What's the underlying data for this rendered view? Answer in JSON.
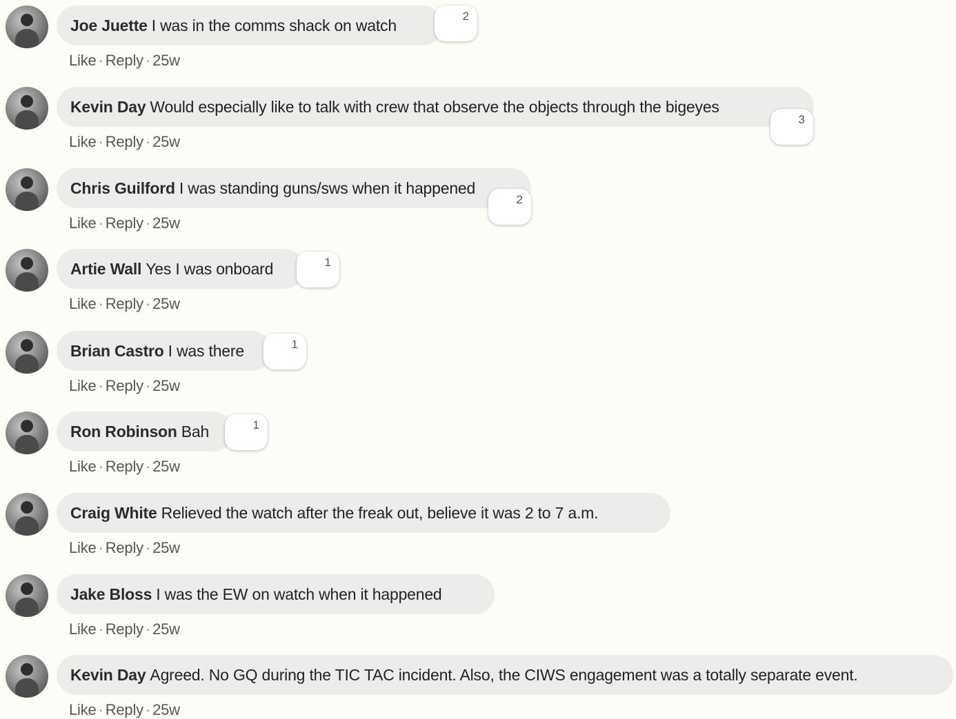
{
  "actions": {
    "like": "Like",
    "reply": "Reply",
    "separator": "·"
  },
  "comments": [
    {
      "author": "Joe Juette",
      "text": "I was in the comms shack on watch",
      "reactions": "2",
      "time": "25w"
    },
    {
      "author": "Kevin Day",
      "text": "Would especially like to talk with crew that observe the objects through the bigeyes",
      "reactions": "3",
      "time": "25w"
    },
    {
      "author": "Chris Guilford",
      "text": "I was standing guns/sws when it happened",
      "reactions": "2",
      "time": "25w"
    },
    {
      "author": "Artie Wall",
      "text": "Yes I was onboard",
      "reactions": "1",
      "time": "25w"
    },
    {
      "author": "Brian Castro",
      "text": "I was there",
      "reactions": "1",
      "time": "25w"
    },
    {
      "author": "Ron Robinson",
      "text": "Bah",
      "reactions": "1",
      "time": "25w"
    },
    {
      "author": "Craig White",
      "text": "Relieved the watch after the freak out, believe it was 2 to 7 a.m.",
      "reactions": "",
      "time": "25w"
    },
    {
      "author": "Jake Bloss",
      "text": "I was the EW on watch when it happened",
      "reactions": "",
      "time": "25w"
    },
    {
      "author": "Kevin Day",
      "text": "Agreed. No GQ during the TIC TAC incident. Also, the CIWS engagement was a totally separate event.",
      "reactions": "",
      "time": "25w"
    }
  ]
}
